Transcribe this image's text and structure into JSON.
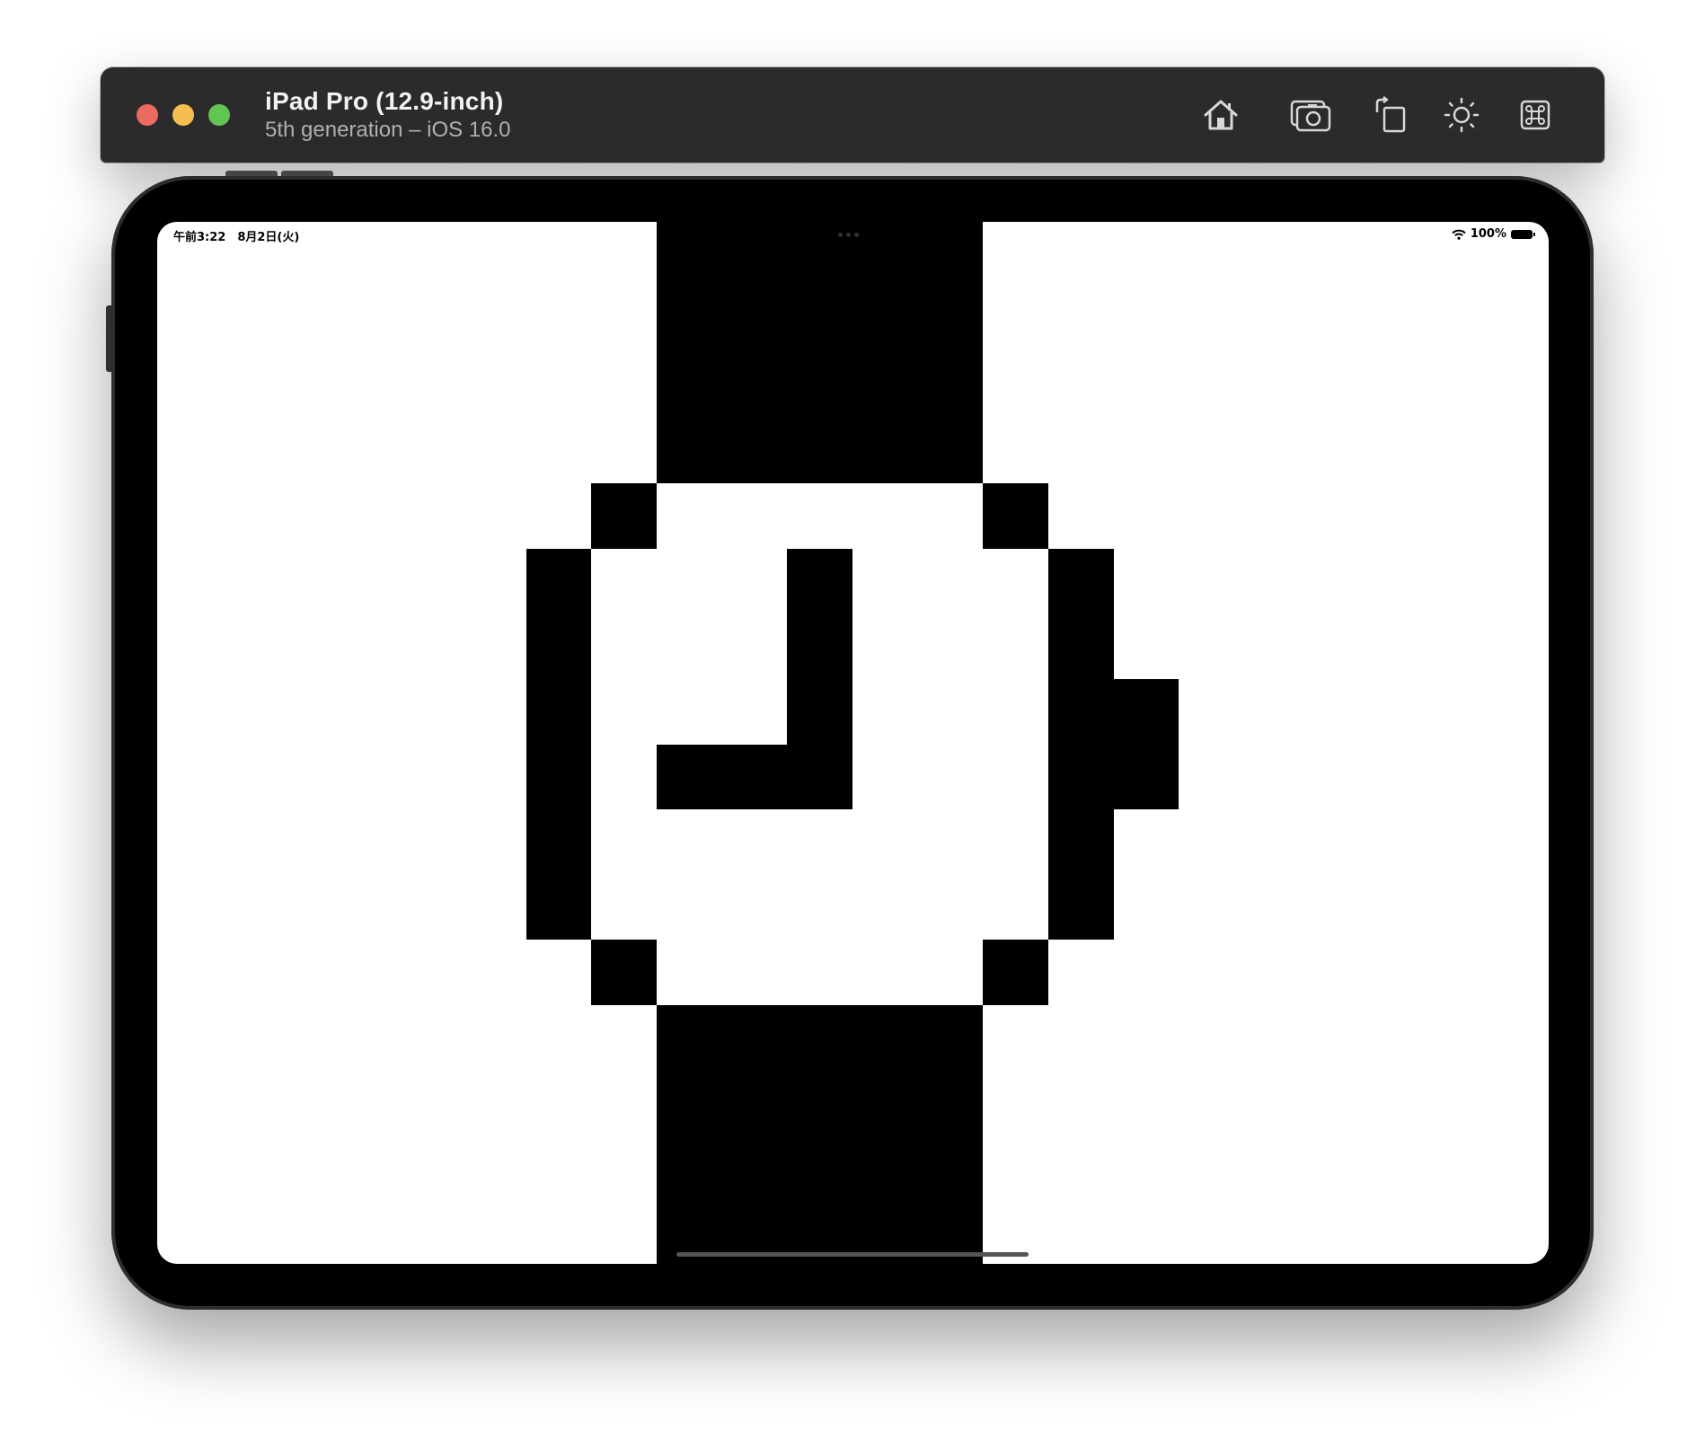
{
  "window": {
    "device_name": "iPad Pro (12.9-inch)",
    "device_subtitle": "5th generation – iOS 16.0",
    "toolbar_icons": [
      "home-icon",
      "screenshot-icon",
      "rotate-icon",
      "appearance-icon",
      "command-icon"
    ],
    "traffic_lights": {
      "close": "#ed6a5e",
      "minimize": "#f5bf4f",
      "zoom": "#61c554"
    }
  },
  "status_bar": {
    "time_date": "午前3:22　8月2日(火)",
    "battery_percent": "100%",
    "wifi_icon": "wifi-icon",
    "battery_icon": "battery-icon"
  },
  "app": {
    "content": "pixel-art-watch-icon",
    "colors": {
      "foreground": "#000000",
      "background": "#ffffff"
    }
  }
}
